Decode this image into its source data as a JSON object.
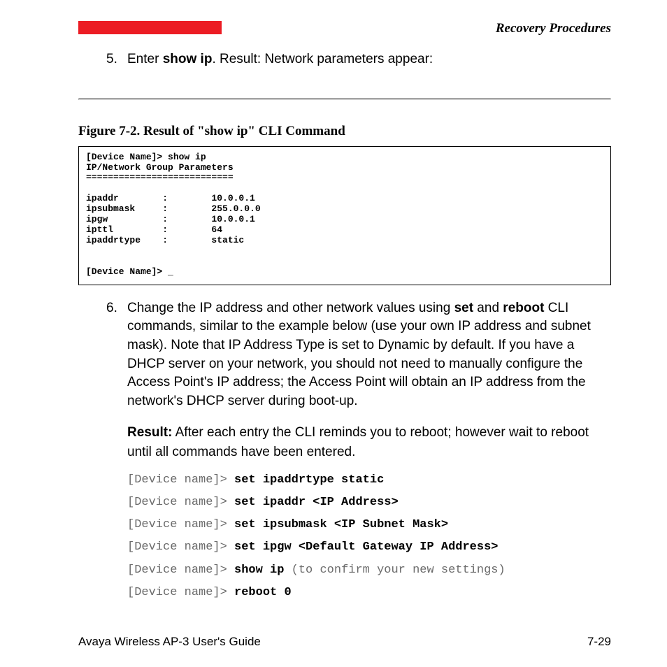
{
  "header": {
    "title": "Recovery Procedures"
  },
  "step5": {
    "number": "5.",
    "text_prefix": "Enter ",
    "bold": "show ip",
    "text_suffix": ". Result: Network parameters appear:"
  },
  "figure": {
    "caption": "Figure 7-2.    Result of \"show ip\" CLI Command"
  },
  "cli": {
    "line1": "[Device Name]> show ip",
    "line2": "IP/Network Group Parameters",
    "line3": "===========================",
    "blank": "",
    "p1": "ipaddr        :        10.0.0.1",
    "p2": "ipsubmask     :        255.0.0.0",
    "p3": "ipgw          :        10.0.0.1",
    "p4": "ipttl         :        64",
    "p5": "ipaddrtype    :        static",
    "prompt": "[Device Name]> _"
  },
  "step6": {
    "number": "6.",
    "seg1": "Change the IP address and other network values using ",
    "b1": "set",
    "seg2": " and ",
    "b2": "reboot",
    "seg3": " CLI commands, similar to the example below (use your own IP address and subnet mask). Note that IP Address Type is set to Dynamic by default. If you have a DHCP server on your network, you should not need to manually configure the Access Point's IP address; the Access Point will obtain an IP address from the network's DHCP server during boot-up."
  },
  "result": {
    "label": "Result:",
    "text": " After each entry the CLI reminds you to reboot; however wait to reboot until all commands have been entered."
  },
  "commands": {
    "prompt": "[Device name]> ",
    "show_suffix": " (to confirm your new settings)",
    "c1": "set ipaddrtype static",
    "c2": "set ipaddr <IP Address>",
    "c3": "set ipsubmask <IP Subnet Mask>",
    "c4": "set ipgw <Default Gateway IP Address>",
    "c5": "show ip",
    "c6": "reboot 0"
  },
  "footer": {
    "left": "Avaya Wireless AP-3 User's Guide",
    "right": "7-29"
  }
}
